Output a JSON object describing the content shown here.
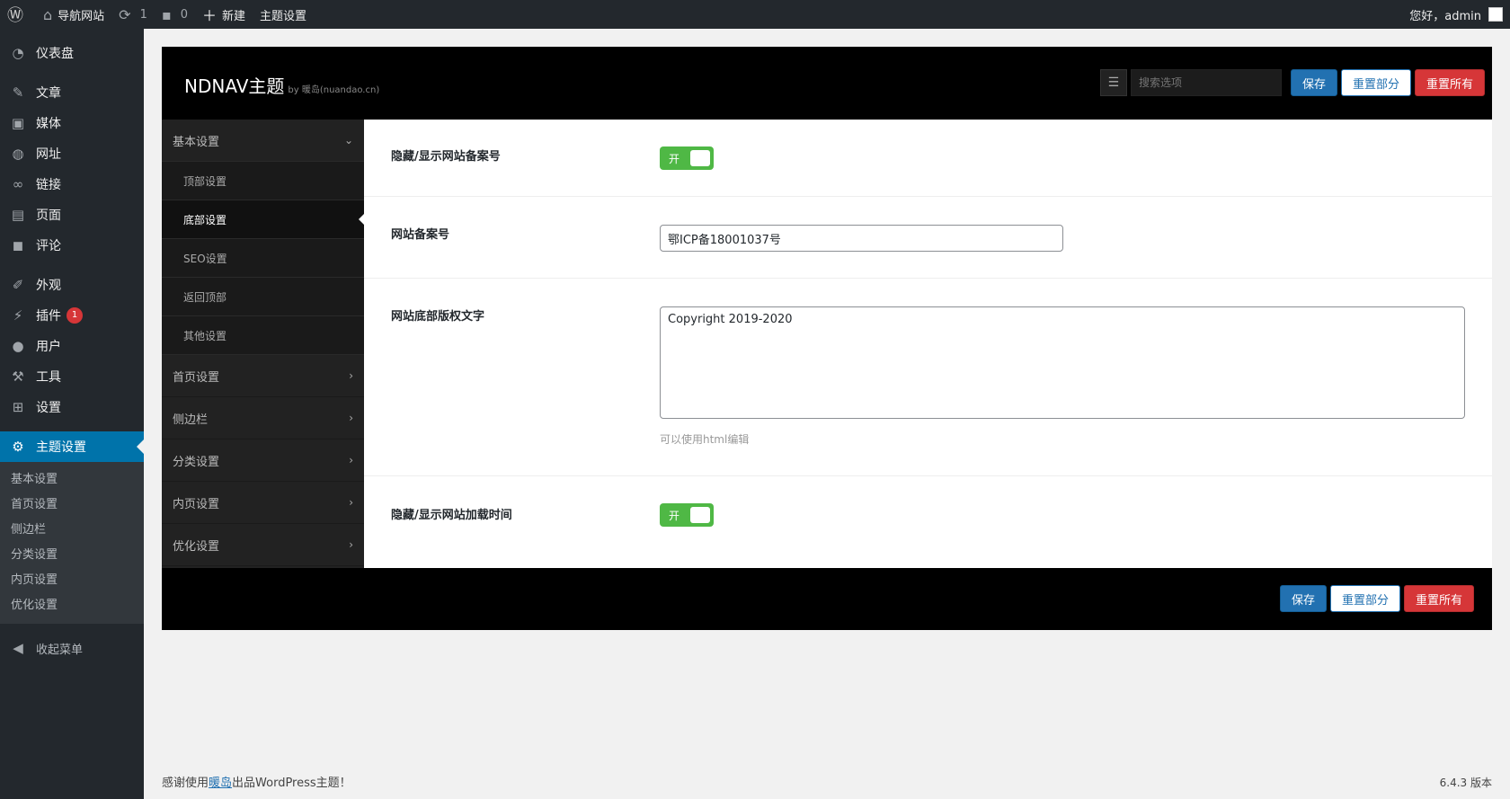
{
  "adminbar": {
    "site_name": "导航网站",
    "updates_count": "1",
    "comments_count": "0",
    "new_label": "新建",
    "theme_settings_label": "主题设置",
    "greeting": "您好，admin"
  },
  "sidebar": {
    "items": [
      {
        "label": "仪表盘",
        "icon": "dashboard-icon"
      },
      {
        "label": "文章",
        "icon": "pin-icon"
      },
      {
        "label": "媒体",
        "icon": "media-icon"
      },
      {
        "label": "网址",
        "icon": "globe-icon"
      },
      {
        "label": "链接",
        "icon": "link-icon"
      },
      {
        "label": "页面",
        "icon": "page-icon"
      },
      {
        "label": "评论",
        "icon": "comment-icon"
      },
      {
        "label": "外观",
        "icon": "brush-icon"
      },
      {
        "label": "插件",
        "icon": "plugin-icon",
        "badge": "1"
      },
      {
        "label": "用户",
        "icon": "user-icon"
      },
      {
        "label": "工具",
        "icon": "wrench-icon"
      },
      {
        "label": "设置",
        "icon": "settings-icon"
      },
      {
        "label": "主题设置",
        "icon": "gear-icon"
      }
    ],
    "submenu": [
      "基本设置",
      "首页设置",
      "侧边栏",
      "分类设置",
      "内页设置",
      "优化设置"
    ],
    "collapse_label": "收起菜单"
  },
  "panel": {
    "brand": "NDNAV主题",
    "brand_by": "by 暖岛(nuandao.cn)",
    "search_placeholder": "搜索选项",
    "save": "保存",
    "reset_section": "重置部分",
    "reset_all": "重置所有",
    "nav": {
      "basic": "基本设置",
      "basic_subs": [
        "顶部设置",
        "底部设置",
        "SEO设置",
        "返回顶部",
        "其他设置"
      ],
      "groups": [
        "首页设置",
        "侧边栏",
        "分类设置",
        "内页设置",
        "优化设置"
      ]
    },
    "fields": {
      "icp_toggle_title": "隐藏/显示网站备案号",
      "toggle_on": "开",
      "icp_title": "网站备案号",
      "icp_value": "鄂ICP备18001037号",
      "copyright_title": "网站底部版权文字",
      "copyright_value": "Copyright 2019-2020",
      "copyright_help": "可以使用html编辑",
      "loadtime_title": "隐藏/显示网站加载时间"
    }
  },
  "footer": {
    "thanks_prefix": "感谢使用",
    "thanks_link": "暖岛",
    "thanks_suffix": "出品WordPress主题！",
    "version": "6.4.3 版本"
  },
  "colors": {
    "admin_dark": "#23282d",
    "active_blue": "#0073aa",
    "toggle_green": "#4fb845",
    "reset_red": "#d63638"
  }
}
